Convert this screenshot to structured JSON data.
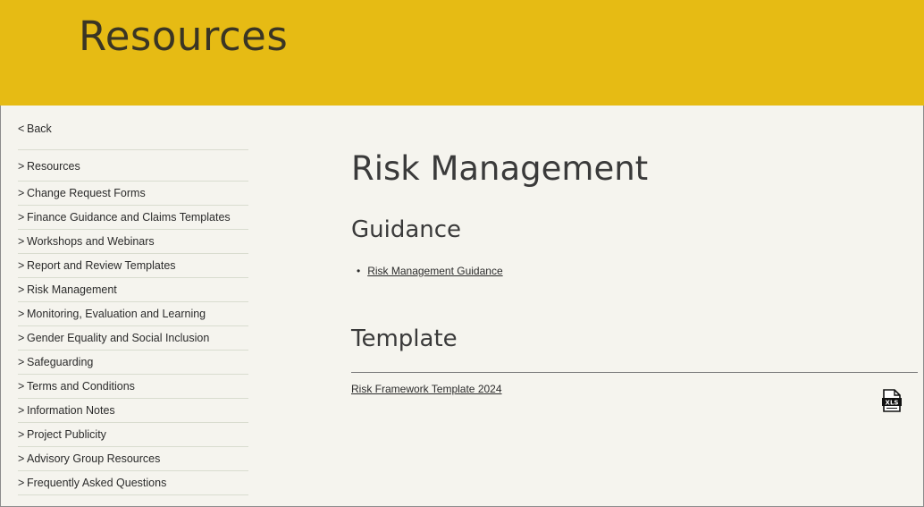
{
  "banner": {
    "title": "Resources"
  },
  "sidebar": {
    "back_label": "Back",
    "items": [
      {
        "label": "Resources"
      },
      {
        "label": "Change Request Forms"
      },
      {
        "label": "Finance Guidance and Claims Templates"
      },
      {
        "label": "Workshops and Webinars"
      },
      {
        "label": "Report and Review Templates"
      },
      {
        "label": "Risk Management"
      },
      {
        "label": "Monitoring, Evaluation and Learning"
      },
      {
        "label": "Gender Equality and Social Inclusion"
      },
      {
        "label": "Safeguarding"
      },
      {
        "label": "Terms and Conditions"
      },
      {
        "label": "Information Notes"
      },
      {
        "label": "Project Publicity"
      },
      {
        "label": "Advisory Group Resources"
      },
      {
        "label": "Frequently Asked Questions"
      }
    ]
  },
  "main": {
    "title": "Risk Management",
    "guidance": {
      "heading": "Guidance",
      "links": [
        {
          "label": "Risk Management Guidance"
        }
      ]
    },
    "template": {
      "heading": "Template",
      "files": [
        {
          "label": "Risk Framework Template 2024",
          "icon": "xls-file-icon",
          "icon_text": "XLS"
        }
      ]
    }
  },
  "colors": {
    "banner": "#e6bb14",
    "background": "#f5f4ee"
  }
}
